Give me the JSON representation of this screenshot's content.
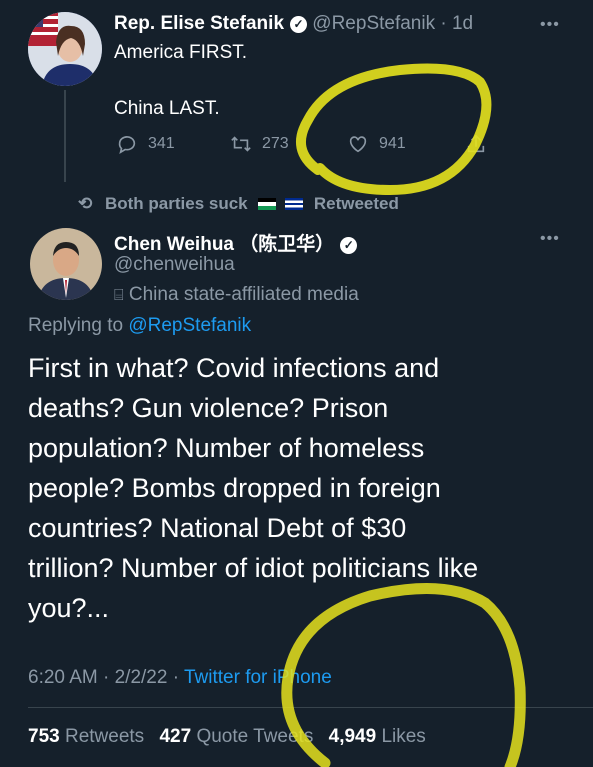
{
  "tweet1": {
    "name": "Rep. Elise Stefanik",
    "handle": "@RepStefanik",
    "time": "· 1d",
    "line1": "America FIRST.",
    "line2": "China LAST.",
    "replies": "341",
    "retweets": "273",
    "likes": "941"
  },
  "retweet_banner": {
    "left": "Both parties suck",
    "right": "Retweeted"
  },
  "tweet2": {
    "name": "Chen Weihua （陈卫华）",
    "handle": "@chenweihua",
    "affiliation": "China state-affiliated media",
    "replying_label": "Replying to ",
    "replying_handle": "@RepStefanik",
    "body": [
      "First in what? Covid infections and",
      "deaths? Gun violence? Prison",
      "population? Number of homeless",
      "people? Bombs dropped in foreign",
      "countries? National Debt of $30",
      "trillion? Number of idiot politicians like",
      "you?..."
    ],
    "timestamp": "6:20 AM · 2/2/22 ·",
    "source": "Twitter for iPhone",
    "stats": {
      "retweets_count": "753",
      "retweets_label": "Retweets",
      "quotes_count": "427",
      "quotes_label": "Quote Tweets",
      "likes_count": "4,949",
      "likes_label": "Likes"
    }
  },
  "colors": {
    "background": "#15202b",
    "muted": "#8b98a5",
    "link": "#1d9bf0",
    "highlight": "#e5e21d"
  },
  "icons": [
    "reply-icon",
    "retweet-icon",
    "like-icon",
    "share-icon",
    "more-icon",
    "verified-icon",
    "media-badge-icon",
    "flag-icon"
  ]
}
